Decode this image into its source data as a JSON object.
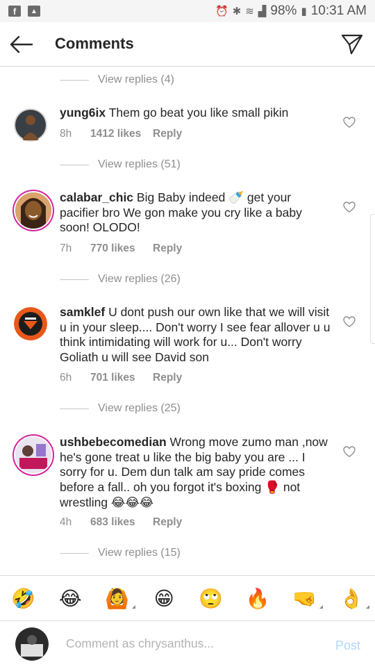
{
  "status_bar": {
    "battery": "98%",
    "time": "10:31 AM",
    "left_icons": [
      "facebook-icon",
      "gallery-icon"
    ]
  },
  "header": {
    "title": "Comments"
  },
  "thread": [
    {
      "type": "view_replies",
      "label": "View replies (4)"
    },
    {
      "type": "comment",
      "username": "yung6ix",
      "text": "Them go beat you like small pikin",
      "time": "8h",
      "likes": "1412 likes",
      "reply": "Reply",
      "has_story_ring": false,
      "avatar_colors": [
        "#3a3f45",
        "#7a4f2e"
      ]
    },
    {
      "type": "view_replies",
      "label": "View replies (51)"
    },
    {
      "type": "comment",
      "username": "calabar_chic",
      "text": "Big Baby indeed 🍼 get your pacifier bro We gon make you cry like a baby soon! OLODO!",
      "time": "7h",
      "likes": "770 likes",
      "reply": "Reply",
      "has_story_ring": true,
      "avatar_colors": [
        "#8b5a2b",
        "#d9a36b"
      ]
    },
    {
      "type": "view_replies",
      "label": "View replies (26)"
    },
    {
      "type": "comment",
      "username": "samklef",
      "text": "U dont push our own like that we will visit u in your sleep.... Don't worry I see fear allover u u think intimidating will work for u... Don't worry Goliath u will see David son",
      "time": "6h",
      "likes": "701 likes",
      "reply": "Reply",
      "has_story_ring": false,
      "avatar_colors": [
        "#e8581a",
        "#1c1c1c"
      ]
    },
    {
      "type": "view_replies",
      "label": "View replies (25)"
    },
    {
      "type": "comment",
      "username": "ushbebecomedian",
      "text": "Wrong move zumo man ,now he's gone treat u like the big baby you are ... I sorry for u. Dem dun talk am say pride comes before a fall.. oh you forgot it's boxing 🥊 not wrestling 😂😂😂",
      "time": "4h",
      "likes": "683 likes",
      "reply": "Reply",
      "has_story_ring": true,
      "avatar_colors": [
        "#e9e4ef",
        "#c2185b"
      ]
    },
    {
      "type": "view_replies",
      "label": "View replies (15)"
    }
  ],
  "emoji_bar": [
    "🤣",
    "😂",
    "🙆",
    "😁",
    "🙄",
    "🔥",
    "🤜",
    "👌"
  ],
  "emoji_has_corner": [
    false,
    false,
    true,
    false,
    false,
    false,
    true,
    true
  ],
  "composer": {
    "placeholder": "Comment as chrysanthus...",
    "post": "Post"
  },
  "colors": {
    "accent": "#3897f0",
    "post_disabled": "#b3d6f5",
    "muted": "#8e8e8e",
    "story_ring": "#d6249f"
  }
}
